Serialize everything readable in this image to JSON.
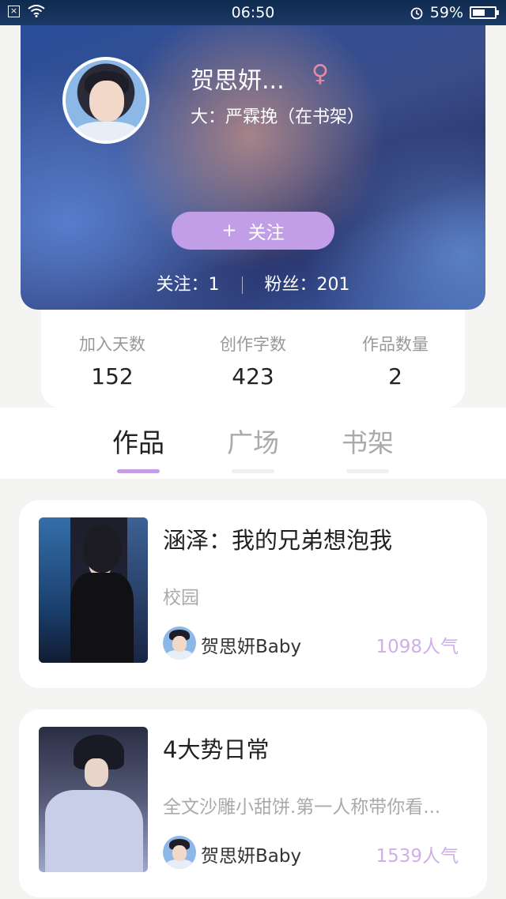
{
  "status_bar": {
    "time": "06:50",
    "battery": "59%",
    "battery_level": 0.59,
    "icons": [
      "close-box-icon",
      "wifi-icon",
      "alarm-icon",
      "battery-icon"
    ]
  },
  "profile": {
    "name": "贺思妍...",
    "gender_symbol": "♀",
    "subtitle": "大：严霖挽（在书架）",
    "follow_button": "关注",
    "follow_plus": "+",
    "following_label": "关注：",
    "following_count": "1",
    "fans_label": "粉丝：",
    "fans_count": "201"
  },
  "stats": [
    {
      "label": "加入天数",
      "value": "152"
    },
    {
      "label": "创作字数",
      "value": "423"
    },
    {
      "label": "作品数量",
      "value": "2"
    }
  ],
  "tabs": [
    {
      "label": "作品",
      "active": true
    },
    {
      "label": "广场",
      "active": false
    },
    {
      "label": "书架",
      "active": false
    }
  ],
  "works": [
    {
      "title": "涵泽：我的兄弟想泡我",
      "description": "校园",
      "author": "贺思妍Baby",
      "popularity": "1098人气"
    },
    {
      "title": "4大势日常",
      "description": "全文沙雕小甜饼.第一人称带你看...",
      "author": "贺思妍Baby",
      "popularity": "1539人气"
    }
  ],
  "colors": {
    "accent": "#c29ee6",
    "popularity": "#d0aee8",
    "gender": "#e28aa6"
  }
}
